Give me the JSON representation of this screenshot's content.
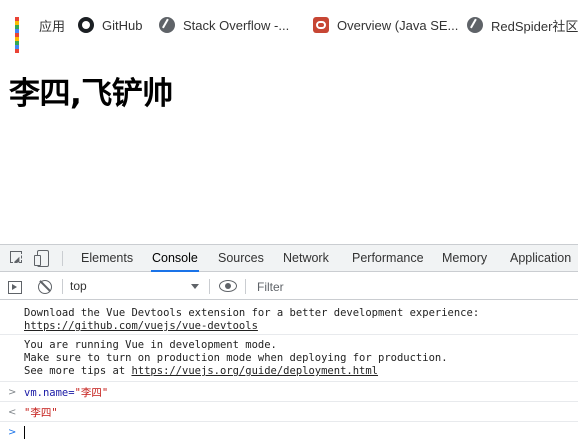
{
  "bookmarks": {
    "items": [
      {
        "label": "应用",
        "icon": "apps-grid-icon"
      },
      {
        "label": "GitHub",
        "icon": "github-icon"
      },
      {
        "label": "Stack Overflow -...",
        "icon": "globe-icon"
      },
      {
        "label": "Overview (Java SE...",
        "icon": "oracle-icon"
      },
      {
        "label": "RedSpider社区能",
        "icon": "globe-icon"
      }
    ]
  },
  "page": {
    "heading": "李四,飞铲帅"
  },
  "devtools": {
    "tabs": [
      "Elements",
      "Console",
      "Sources",
      "Network",
      "Performance",
      "Memory",
      "Application"
    ],
    "active_tab": "Console",
    "toolbar": {
      "context": "top",
      "filter_placeholder": "Filter"
    },
    "console": {
      "messages": [
        {
          "lines": [
            "Download the Vue Devtools extension for a better development experience:"
          ],
          "link": "https://github.com/vuejs/vue-devtools"
        },
        {
          "lines": [
            "You are running Vue in development mode.",
            "Make sure to turn on production mode when deploying for production."
          ],
          "tail_prefix": "See more tips at ",
          "link": "https://vuejs.org/guide/deployment.html"
        }
      ],
      "input_expr_prefix": "vm.name=",
      "input_expr_string": "\"李四\"",
      "result": "\"李四\"",
      "prompt_symbol": ">",
      "result_symbol": "<"
    }
  },
  "colors": {
    "active_tab_underline": "#1a73e8",
    "string_red": "#c41a16",
    "devtools_bg": "#f1f3f4"
  }
}
